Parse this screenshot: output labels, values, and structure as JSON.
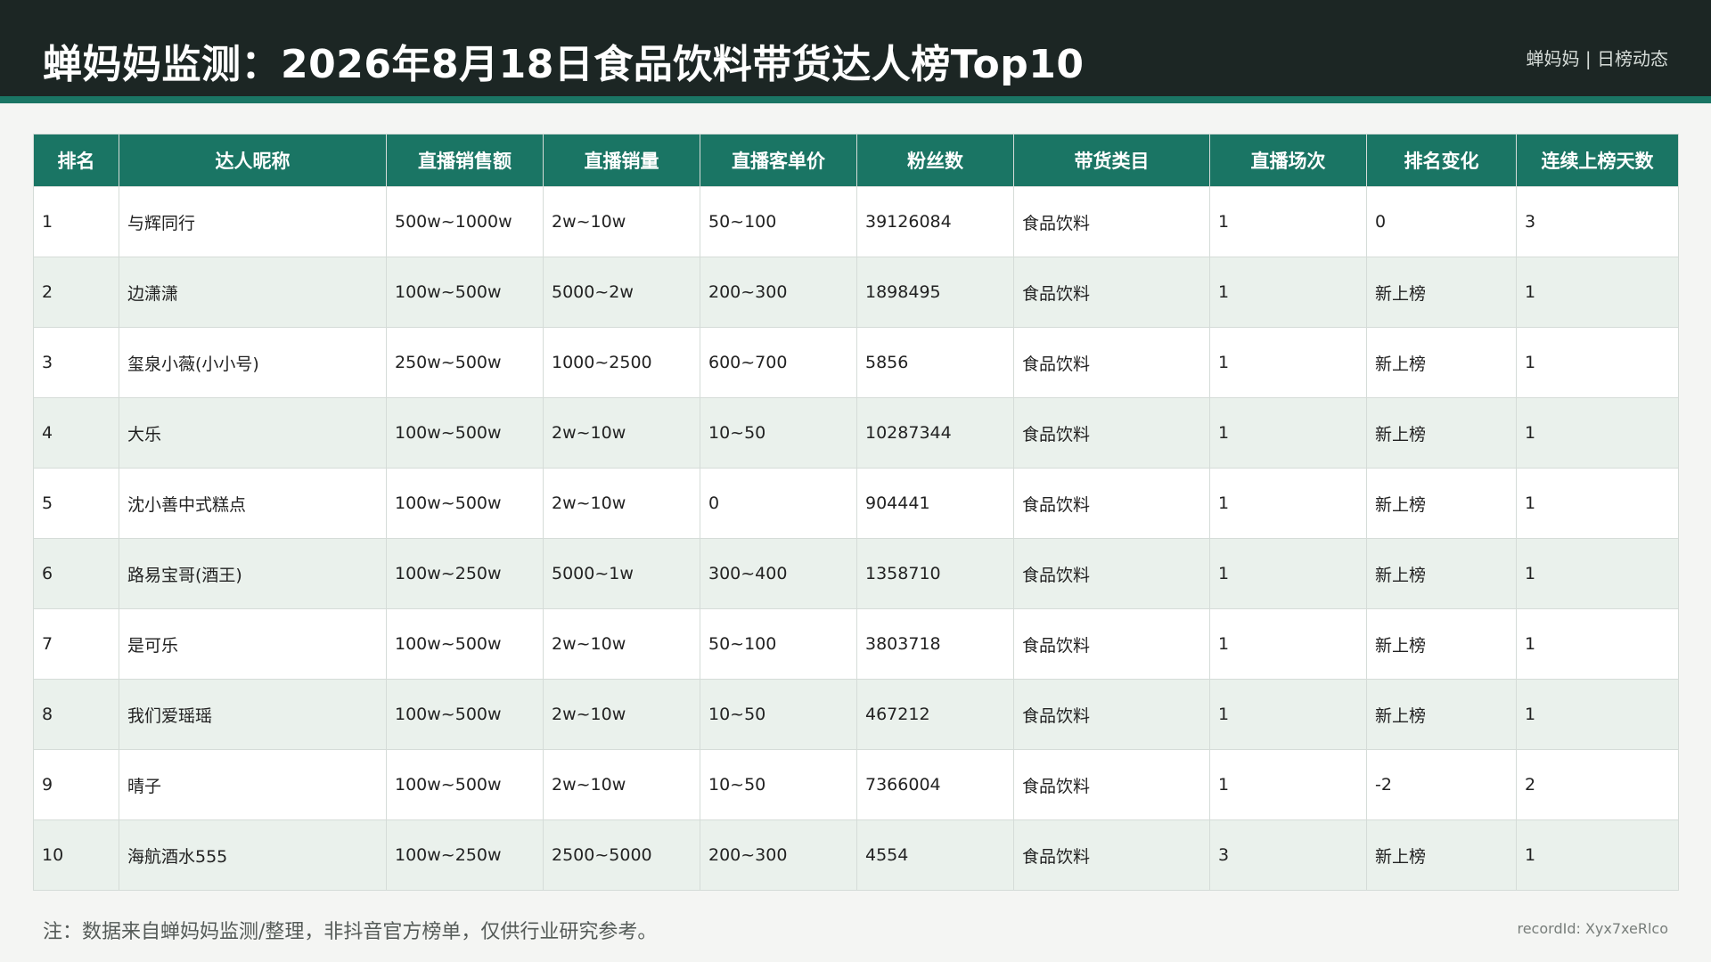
{
  "header": {
    "title": "蝉妈妈监测：2026年8月18日食品饮料带货达人榜Top10",
    "brand": "蝉妈妈 | 日榜动态"
  },
  "table": {
    "columns": [
      "排名",
      "达人昵称",
      "直播销售额",
      "直播销量",
      "直播客单价",
      "粉丝数",
      "带货类目",
      "直播场次",
      "排名变化",
      "连续上榜天数"
    ],
    "rows": [
      [
        "1",
        "与辉同行",
        "500w~1000w",
        "2w~10w",
        "50~100",
        "39126084",
        "食品饮料",
        "1",
        "0",
        "3"
      ],
      [
        "2",
        "边潇潇",
        "100w~500w",
        "5000~2w",
        "200~300",
        "1898495",
        "食品饮料",
        "1",
        "新上榜",
        "1"
      ],
      [
        "3",
        "玺泉小薇(小小号)",
        "250w~500w",
        "1000~2500",
        "600~700",
        "5856",
        "食品饮料",
        "1",
        "新上榜",
        "1"
      ],
      [
        "4",
        "大乐",
        "100w~500w",
        "2w~10w",
        "10~50",
        "10287344",
        "食品饮料",
        "1",
        "新上榜",
        "1"
      ],
      [
        "5",
        "沈小善中式糕点",
        "100w~500w",
        "2w~10w",
        "0",
        "904441",
        "食品饮料",
        "1",
        "新上榜",
        "1"
      ],
      [
        "6",
        "路易宝哥(酒王)",
        "100w~250w",
        "5000~1w",
        "300~400",
        "1358710",
        "食品饮料",
        "1",
        "新上榜",
        "1"
      ],
      [
        "7",
        "是可乐",
        "100w~500w",
        "2w~10w",
        "50~100",
        "3803718",
        "食品饮料",
        "1",
        "新上榜",
        "1"
      ],
      [
        "8",
        "我们爱瑶瑶",
        "100w~500w",
        "2w~10w",
        "10~50",
        "467212",
        "食品饮料",
        "1",
        "新上榜",
        "1"
      ],
      [
        "9",
        "晴子",
        "100w~500w",
        "2w~10w",
        "10~50",
        "7366004",
        "食品饮料",
        "1",
        "-2",
        "2"
      ],
      [
        "10",
        "海航酒水555",
        "100w~250w",
        "2500~5000",
        "200~300",
        "4554",
        "食品饮料",
        "3",
        "新上榜",
        "1"
      ]
    ]
  },
  "footer": {
    "note": "注：数据来自蝉妈妈监测/整理，非抖音官方榜单，仅供行业研究参考。",
    "record": "recordId: Xyx7xeRlco"
  },
  "colors": {
    "header_bg": "#1c2624",
    "accent": "#1a7564",
    "stripe": "#eaf1ec"
  }
}
